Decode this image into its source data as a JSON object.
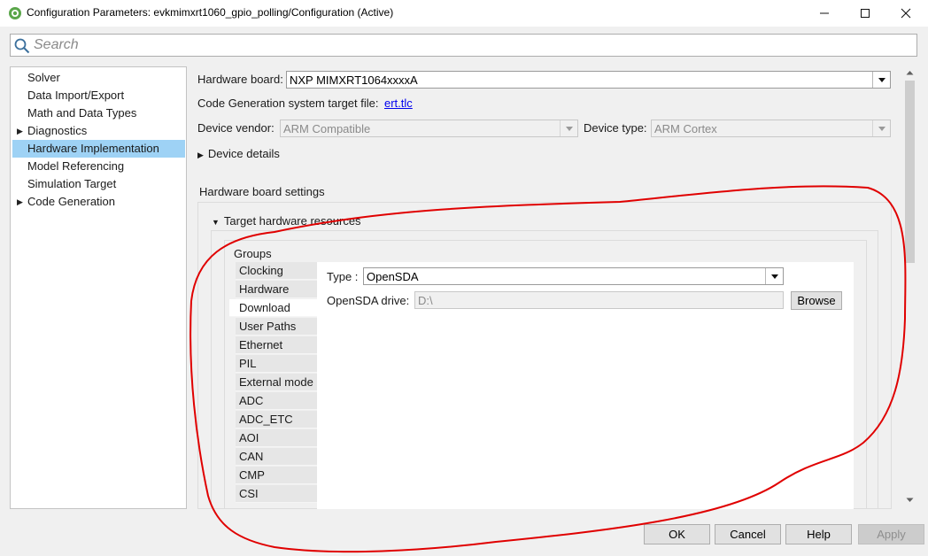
{
  "window": {
    "title": "Configuration Parameters: evkmimxrt1060_gpio_polling/Configuration (Active)"
  },
  "search": {
    "placeholder": "Search"
  },
  "tree": {
    "items": [
      {
        "label": "Solver",
        "expandable": false
      },
      {
        "label": "Data Import/Export",
        "expandable": false
      },
      {
        "label": "Math and Data Types",
        "expandable": false
      },
      {
        "label": "Diagnostics",
        "expandable": true
      },
      {
        "label": "Hardware Implementation",
        "expandable": false,
        "selected": true
      },
      {
        "label": "Model Referencing",
        "expandable": false
      },
      {
        "label": "Simulation Target",
        "expandable": false
      },
      {
        "label": "Code Generation",
        "expandable": true
      }
    ]
  },
  "hardware": {
    "board_label": "Hardware board:",
    "board_value": "NXP MIMXRT1064xxxxA",
    "target_file_label": "Code Generation system target file:",
    "target_file_value": "ert.tlc",
    "vendor_label": "Device vendor:",
    "vendor_value": "ARM Compatible",
    "type_label": "Device type:",
    "type_value": "ARM Cortex",
    "device_details": "Device details",
    "board_settings": "Hardware board settings",
    "target_resources": "Target hardware resources",
    "groups_label": "Groups",
    "groups": [
      "Clocking",
      "Hardware",
      "Download",
      "User Paths",
      "Ethernet",
      "PIL",
      "External mode",
      "ADC",
      "ADC_ETC",
      "AOI",
      "CAN",
      "CMP",
      "CSI"
    ],
    "selected_group": "Download",
    "download": {
      "type_label": "Type :",
      "type_value": "OpenSDA",
      "drive_label": "OpenSDA drive:",
      "drive_value": "D:\\",
      "browse_label": "Browse"
    }
  },
  "buttons": {
    "ok": "OK",
    "cancel": "Cancel",
    "help": "Help",
    "apply": "Apply"
  },
  "colors": {
    "selection": "#9ed2f5",
    "annotation": "#e00000",
    "link": "#0000ee"
  }
}
